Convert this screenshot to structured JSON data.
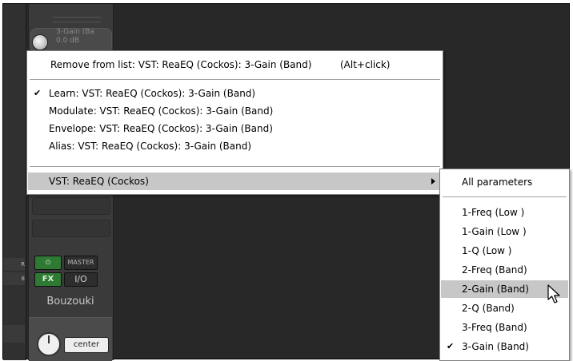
{
  "mixer": {
    "param_name": "3-Gain (Ba",
    "param_value": "0.0 dB",
    "track_name": "Bouzouki",
    "pan_label": "center",
    "fx_label": "FX",
    "master_label": "MASTER",
    "io_label": "I/O",
    "power_glyph": "⏻"
  },
  "context_menu": {
    "remove": "Remove from list: VST: ReaEQ (Cockos): 3-Gain (Band)",
    "remove_shortcut": "(Alt+click)",
    "learn": "Learn: VST: ReaEQ (Cockos): 3-Gain (Band)",
    "learn_checked": true,
    "modulate": "Modulate: VST: ReaEQ (Cockos): 3-Gain (Band)",
    "envelope": "Envelope: VST: ReaEQ (Cockos): 3-Gain (Band)",
    "alias": "Alias: VST: ReaEQ (Cockos): 3-Gain (Band)",
    "plugin": "VST: ReaEQ (Cockos)"
  },
  "submenu": {
    "all_params": "All parameters",
    "items": [
      "1-Freq (Low )",
      "1-Gain (Low )",
      "1-Q (Low )",
      "2-Freq (Band)",
      "2-Gain (Band)",
      "2-Q (Band)",
      "3-Freq (Band)",
      "3-Gain (Band)"
    ],
    "highlighted_index": 4,
    "checked_index": 7
  },
  "colors": {
    "menu_highlight": "#c7c7c7",
    "fx_active": "#2e7a33",
    "mixer_bg": "#282828"
  },
  "icons": {
    "check": "check-icon",
    "submenu_arrow": "submenu-arrow-icon",
    "cursor": "mouse-pointer-icon"
  }
}
